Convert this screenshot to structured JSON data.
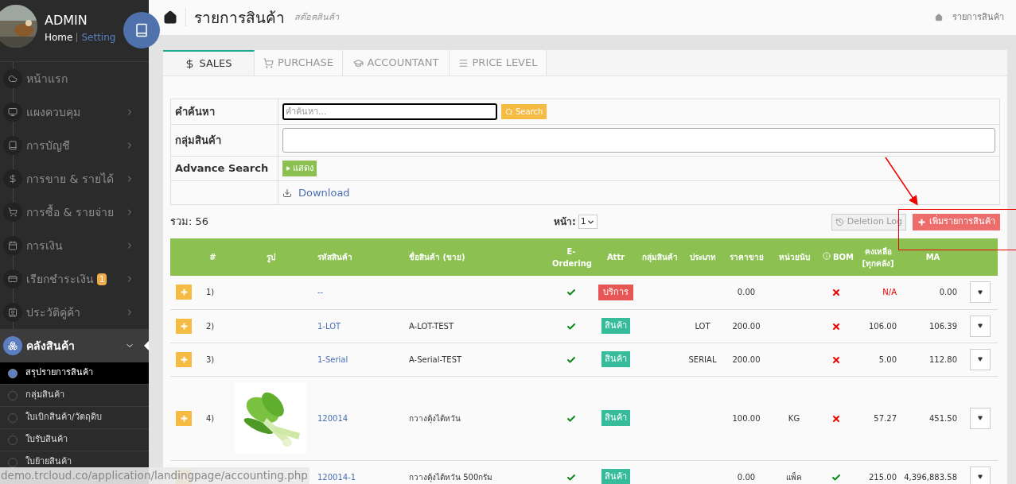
{
  "sidebar": {
    "user": {
      "name": "ADMIN",
      "links": [
        {
          "label": "Home",
          "selected": true
        },
        {
          "label": "Setting",
          "selected": false
        }
      ]
    },
    "items": [
      {
        "label": "หน้าแรก",
        "has_submenu": false,
        "expanded": false,
        "selected": false
      },
      {
        "label": "แผงควบคุม",
        "has_submenu": true,
        "expanded": false,
        "selected": false
      },
      {
        "label": "การบัญชี",
        "has_submenu": true,
        "expanded": false,
        "selected": false
      },
      {
        "label": "การขาย & รายได้",
        "has_submenu": true,
        "expanded": false,
        "selected": false
      },
      {
        "label": "การซื้อ & รายจ่าย",
        "has_submenu": true,
        "expanded": false,
        "selected": false
      },
      {
        "label": "การเงิน",
        "has_submenu": true,
        "expanded": false,
        "selected": false
      },
      {
        "label": "เรียกชำระเงิน",
        "badge": "1",
        "has_submenu": true,
        "expanded": false,
        "selected": false
      },
      {
        "label": "ประวัติคู่ค้า",
        "has_submenu": true,
        "expanded": false,
        "selected": false
      },
      {
        "label": "คลังสินค้า",
        "has_submenu": true,
        "expanded": true,
        "selected": true,
        "children": [
          {
            "label": "สรุปรายการสินค้า",
            "selected": true
          },
          {
            "label": "กลุ่มสินค้า",
            "selected": false
          },
          {
            "label": "ใบเบิกสินค้า/วัตถุดิบ",
            "selected": false
          },
          {
            "label": "ใบรับสินค้า",
            "selected": false
          },
          {
            "label": "ใบย้ายสินค้า",
            "selected": false
          }
        ]
      }
    ]
  },
  "header": {
    "title": "รายการสินค้า",
    "subtitle": "สต๊อคสินค้า",
    "breadcrumb": "รายการสินค้า"
  },
  "tabs": [
    {
      "label": "SALES",
      "selected": true
    },
    {
      "label": "PURCHASE",
      "selected": false
    },
    {
      "label": "ACCOUNTANT",
      "selected": false
    },
    {
      "label": "PRICE LEVEL",
      "selected": false
    }
  ],
  "filters": {
    "search_label": "คำค้นหา",
    "search_placeholder": "คำค้นหา...",
    "search_button": "Search",
    "group_label": "กลุ่มสินค้า",
    "advance_label": "Advance Search",
    "advance_button": "แสดง",
    "download": "Download"
  },
  "summary": {
    "total": "รวม: 56",
    "page_label": "หน้า:",
    "page": "1",
    "deletion_log": "Deletion Log",
    "add_button": "เพิ่มรายการสินค้า"
  },
  "table": {
    "columns": [
      "#",
      "รูป",
      "รหัสสินค้า",
      "ชื่อสินค้า (ขาย)",
      "E-Ordering",
      "Attr",
      "กลุ่มสินค้า",
      "ประเภท",
      "ราคาขาย",
      "หน่วยนับ",
      "BOM",
      "คงเหลือ [ทุกคลัง]",
      "MA"
    ],
    "rows": [
      {
        "num": "1)",
        "picture": false,
        "code": "--",
        "name": "",
        "e_ordering": true,
        "attr": {
          "label": "บริการ",
          "kind": "service"
        },
        "type": "",
        "price": "0.00",
        "unit": "",
        "bom": false,
        "stock": "N/A",
        "stock_warning": true,
        "ma": "0.00"
      },
      {
        "num": "2)",
        "picture": false,
        "code": "1-LOT",
        "name": "A-LOT-TEST",
        "e_ordering": true,
        "attr": {
          "label": "สินค้า",
          "kind": "product"
        },
        "type": "LOT",
        "price": "200.00",
        "unit": "",
        "bom": false,
        "stock": "106.00",
        "stock_warning": false,
        "ma": "106.39"
      },
      {
        "num": "3)",
        "picture": false,
        "code": "1-Serial",
        "name": "A-Serial-TEST",
        "e_ordering": true,
        "attr": {
          "label": "สินค้า",
          "kind": "product"
        },
        "type": "SERIAL",
        "price": "200.00",
        "unit": "",
        "bom": false,
        "stock": "5.00",
        "stock_warning": false,
        "ma": "112.80"
      },
      {
        "num": "4)",
        "picture": true,
        "code": "120014",
        "name": "กวางตุ้งไต้หวัน",
        "e_ordering": true,
        "attr": {
          "label": "สินค้า",
          "kind": "product"
        },
        "type": "",
        "price": "100.00",
        "unit": "KG",
        "bom": false,
        "stock": "57.27",
        "stock_warning": false,
        "ma": "451.50"
      },
      {
        "picture": false,
        "code": "120014-1",
        "name": "กวางตุ้งไต้หวัน 500กรัม",
        "e_ordering": true,
        "attr": {
          "label": "สินค้า",
          "kind": "product"
        },
        "type": "",
        "price": "0.00",
        "unit": "แพ็ค",
        "bom": true,
        "stock": "215.00",
        "stock_warning": false,
        "ma": "4,396,883.58"
      }
    ]
  },
  "status_url": "demo.trcloud.co/application/landingpage/accounting.php"
}
